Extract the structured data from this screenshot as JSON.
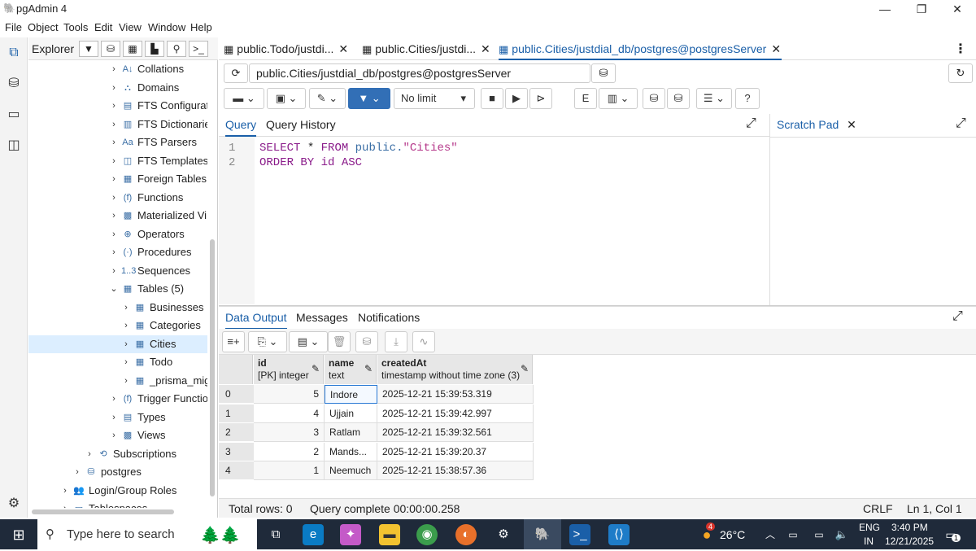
{
  "window": {
    "title": "pgAdmin 4",
    "minimize": "—",
    "maximize": "❐",
    "close": "✕"
  },
  "menu": [
    "File",
    "Object",
    "Tools",
    "Edit",
    "View",
    "Window",
    "Help"
  ],
  "explorer": {
    "title": "Explorer",
    "tree": [
      {
        "label": "Collations",
        "icon": "collations-icon",
        "glyph": "A↓"
      },
      {
        "label": "Domains",
        "icon": "domains-icon",
        "glyph": "⛬"
      },
      {
        "label": "FTS Configurat",
        "icon": "fts-config-icon",
        "glyph": "▤"
      },
      {
        "label": "FTS Dictionarie",
        "icon": "fts-dictionary-icon",
        "glyph": "▥"
      },
      {
        "label": "FTS Parsers",
        "icon": "fts-parser-icon",
        "glyph": "Aa"
      },
      {
        "label": "FTS Templates",
        "icon": "fts-template-icon",
        "glyph": "◫"
      },
      {
        "label": "Foreign Tables",
        "icon": "foreign-table-icon",
        "glyph": "▦"
      },
      {
        "label": "Functions",
        "icon": "function-icon",
        "glyph": "(f)"
      },
      {
        "label": "Materialized Vi",
        "icon": "matview-icon",
        "glyph": "▩"
      },
      {
        "label": "Operators",
        "icon": "operator-icon",
        "glyph": "⊕"
      },
      {
        "label": "Procedures",
        "icon": "procedure-icon",
        "glyph": "(·)"
      },
      {
        "label": "Sequences",
        "icon": "sequence-icon",
        "glyph": "1..3"
      },
      {
        "label": "Tables",
        "count": "(5)",
        "icon": "tables-icon",
        "glyph": "▦"
      },
      {
        "label": "Businesses",
        "icon": "table-icon",
        "glyph": "▦"
      },
      {
        "label": "Categories",
        "icon": "table-icon",
        "glyph": "▦"
      },
      {
        "label": "Cities",
        "icon": "table-icon",
        "glyph": "▦"
      },
      {
        "label": "Todo",
        "icon": "table-icon",
        "glyph": "▦"
      },
      {
        "label": "_prisma_mig",
        "icon": "table-icon",
        "glyph": "▦"
      },
      {
        "label": "Trigger Functio",
        "icon": "trigger-function-icon",
        "glyph": "(f)"
      },
      {
        "label": "Types",
        "icon": "types-icon",
        "glyph": "▤"
      },
      {
        "label": "Views",
        "icon": "views-icon",
        "glyph": "▩"
      },
      {
        "label": "Subscriptions",
        "icon": "subscriptions-icon",
        "glyph": "⟲"
      },
      {
        "label": "postgres",
        "icon": "database-icon",
        "glyph": "⛁"
      },
      {
        "label": "Login/Group Roles",
        "icon": "roles-icon",
        "glyph": "👥"
      },
      {
        "label": "Tablespaces",
        "icon": "tablespace-icon",
        "glyph": "▭"
      }
    ]
  },
  "tabs": [
    {
      "label": "public.Todo/justdi...",
      "active": false
    },
    {
      "label": "public.Cities/justdi...",
      "active": false
    },
    {
      "label": "public.Cities/justdial_db/postgres@postgresServer",
      "active": true
    }
  ],
  "connection": "public.Cities/justdial_db/postgres@postgresServer",
  "toolbar": {
    "limit": "No limit"
  },
  "query": {
    "tab_query": "Query",
    "tab_history": "Query History",
    "lines": [
      "1",
      "2"
    ],
    "sql_l1_kw1": "SELECT",
    "sql_l1_star": "*",
    "sql_l1_kw2": "FROM",
    "sql_l1_schema": "public.",
    "sql_l1_table": "\"Cities\"",
    "sql_l2_kw": "ORDER BY",
    "sql_l2_col": "id",
    "sql_l2_dir": "ASC"
  },
  "scratch": {
    "title": "Scratch Pad"
  },
  "output": {
    "tabs": [
      "Data Output",
      "Messages",
      "Notifications"
    ],
    "columns": [
      {
        "name": "id",
        "type": "[PK] integer"
      },
      {
        "name": "name",
        "type": "text"
      },
      {
        "name": "createdAt",
        "type": "timestamp without time zone (3)"
      }
    ],
    "rows": [
      {
        "n": "0",
        "id": "5",
        "name": "Indore",
        "createdAt": "2025-12-21 15:39:53.319"
      },
      {
        "n": "1",
        "id": "4",
        "name": "Ujjain",
        "createdAt": "2025-12-21 15:39:42.997"
      },
      {
        "n": "2",
        "id": "3",
        "name": "Ratlam",
        "createdAt": "2025-12-21 15:39:32.561"
      },
      {
        "n": "3",
        "id": "2",
        "name": "Mands...",
        "createdAt": "2025-12-21 15:39:20.37"
      },
      {
        "n": "4",
        "id": "1",
        "name": "Neemuch",
        "createdAt": "2025-12-21 15:38:57.36"
      }
    ]
  },
  "status": {
    "total_rows": "Total rows: 0",
    "query_complete": "Query complete 00:00:00.258",
    "eol": "CRLF",
    "position": "Ln 1, Col 1"
  },
  "taskbar": {
    "search_placeholder": "Type here to search",
    "weather": "26°C",
    "weather_badge": "4",
    "lang1": "ENG",
    "lang2": "IN",
    "time": "3:40 PM",
    "date": "12/21/2025",
    "notif_count": "1"
  }
}
